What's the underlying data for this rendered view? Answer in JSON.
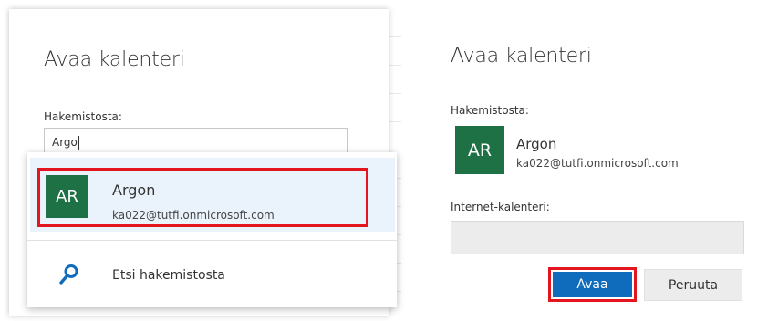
{
  "left_dialog": {
    "title": "Avaa kalenteri",
    "directory_label": "Hakemistosta:",
    "search_value": "Argo",
    "suggestion": {
      "initials": "AR",
      "name": "Argon",
      "email": "ka022@tutfi.onmicrosoft.com"
    },
    "search_directory_label": "Etsi hakemistosta"
  },
  "right_dialog": {
    "title": "Avaa kalenteri",
    "directory_label": "Hakemistosta:",
    "selected_person": {
      "initials": "AR",
      "name": "Argon",
      "email": "ka022@tutfi.onmicrosoft.com"
    },
    "internet_calendar_label": "Internet-kalenteri:",
    "internet_calendar_value": "",
    "open_button_label": "Avaa",
    "cancel_button_label": "Peruuta"
  },
  "colors": {
    "avatar": "#1e7145",
    "primary_button": "#0f6cbd",
    "highlight": "#e3151f",
    "suggestion_bg": "#eaf3fb"
  },
  "icons": {
    "search_directory": "search-icon"
  }
}
